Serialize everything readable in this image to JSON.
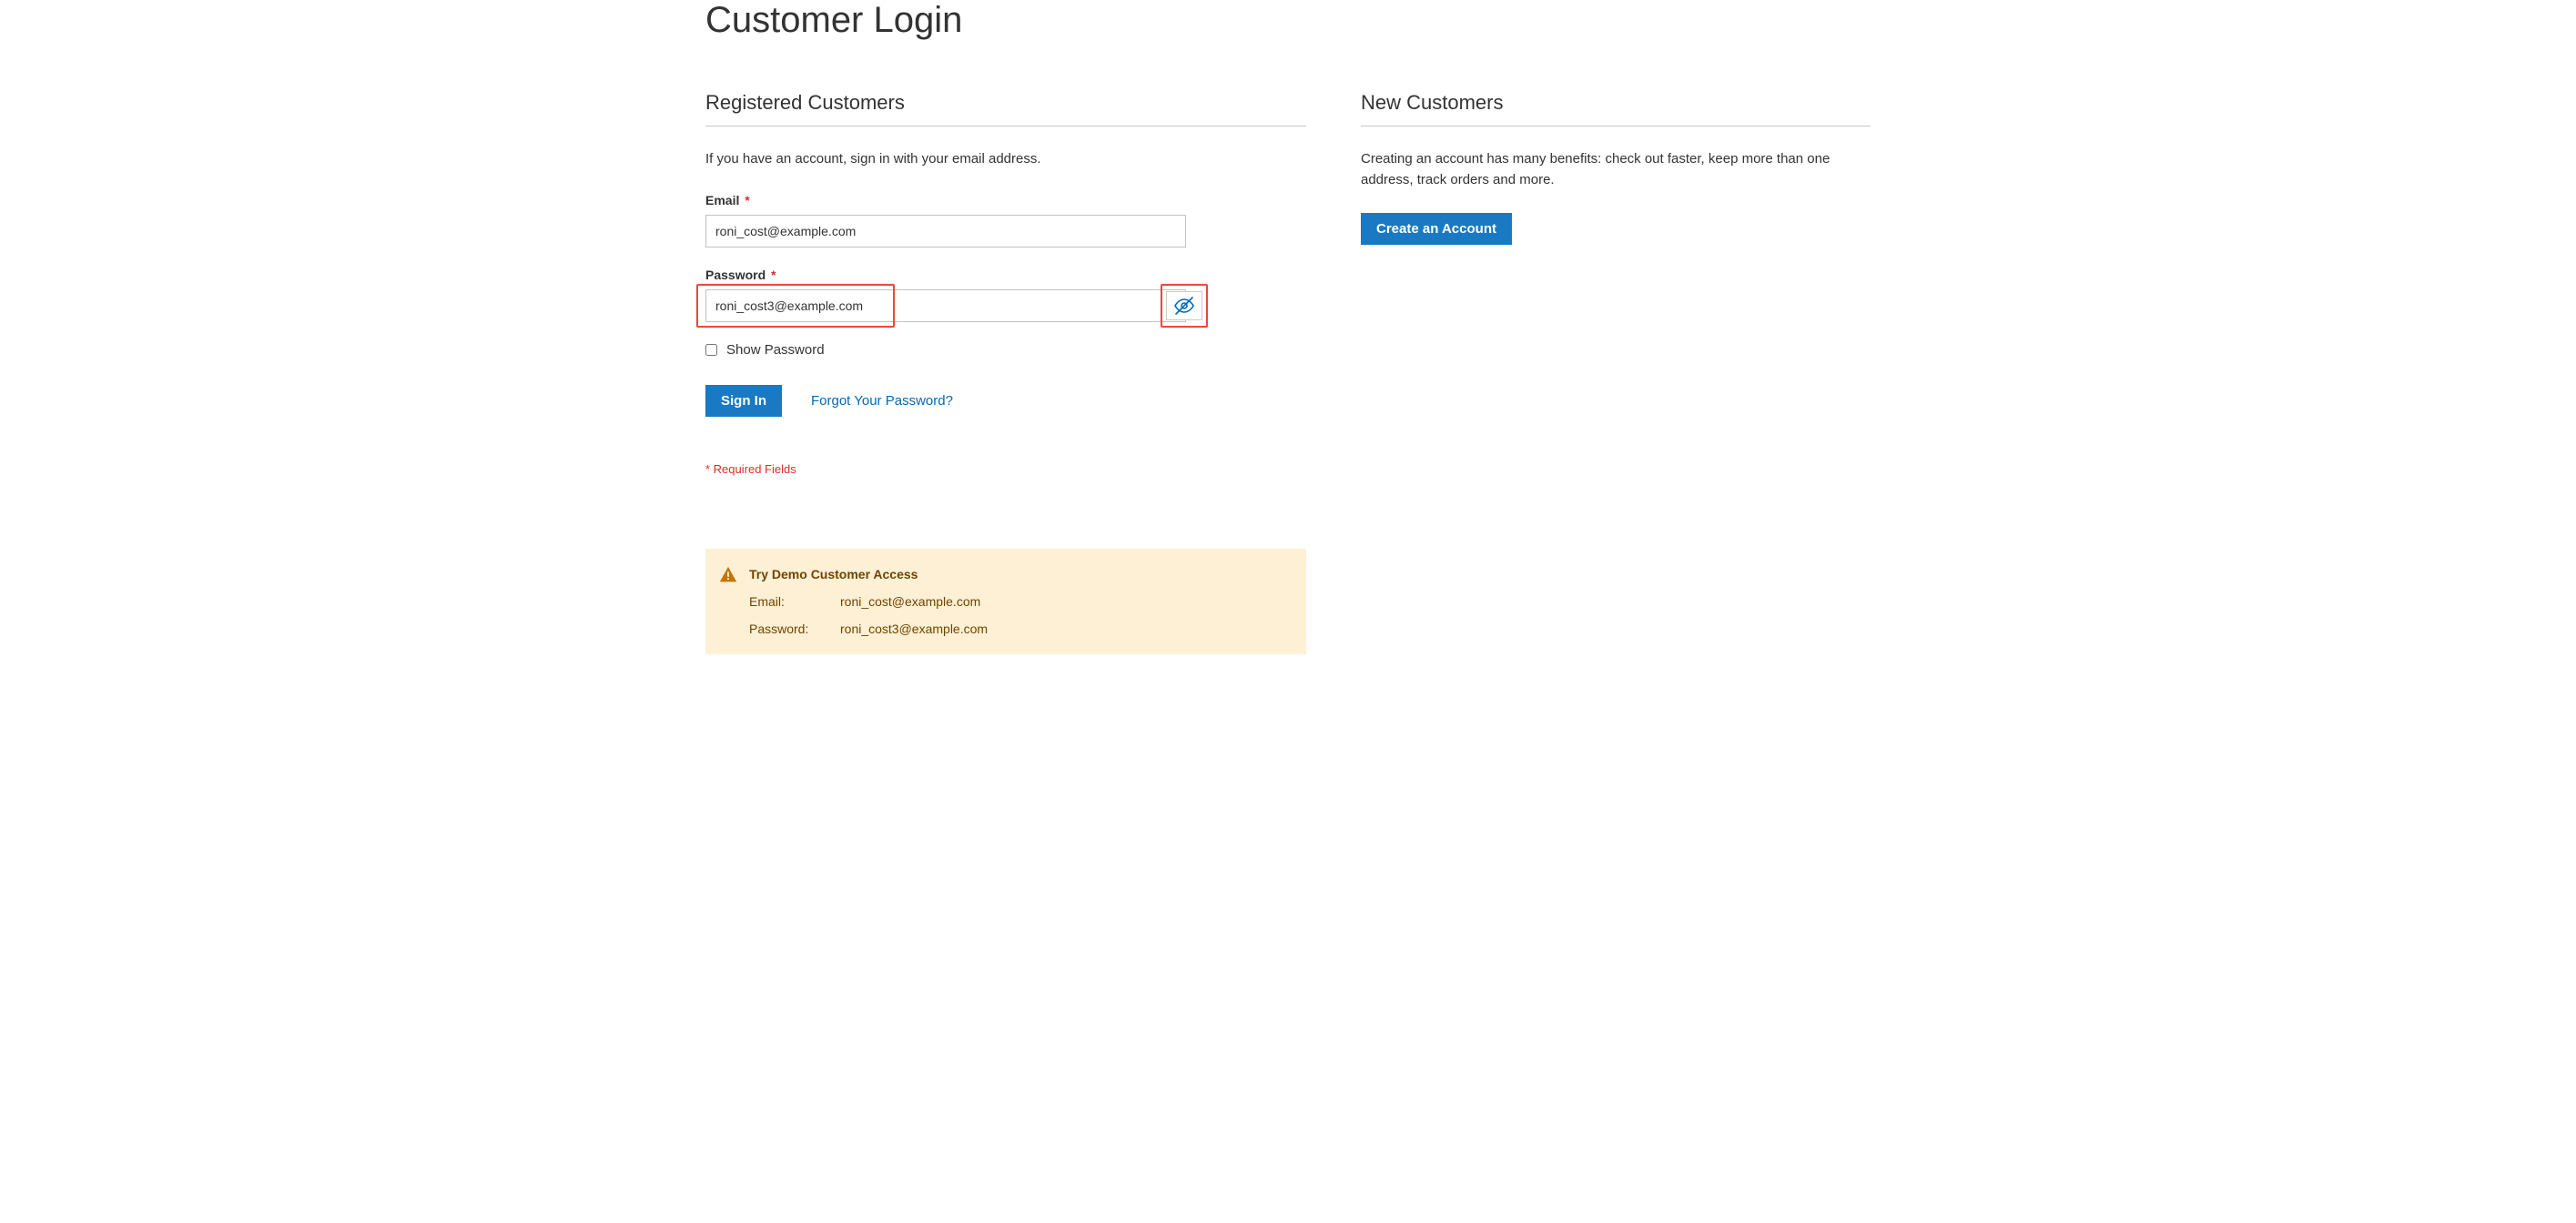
{
  "page": {
    "title": "Customer Login"
  },
  "login": {
    "heading": "Registered Customers",
    "description": "If you have an account, sign in with your email address.",
    "email_label": "Email",
    "email_value": "roni_cost@example.com",
    "password_label": "Password",
    "password_value": "roni_cost3@example.com",
    "show_password_label": "Show Password",
    "signin_label": "Sign In",
    "forgot_label": "Forgot Your Password?",
    "required_note": "* Required Fields"
  },
  "new_customers": {
    "heading": "New Customers",
    "description": "Creating an account has many benefits: check out faster, keep more than one address, track orders and more.",
    "create_label": "Create an Account"
  },
  "demo": {
    "title": "Try Demo Customer Access",
    "email_label": "Email:",
    "email_value": "roni_cost@example.com",
    "password_label": "Password:",
    "password_value": "roni_cost3@example.com"
  }
}
